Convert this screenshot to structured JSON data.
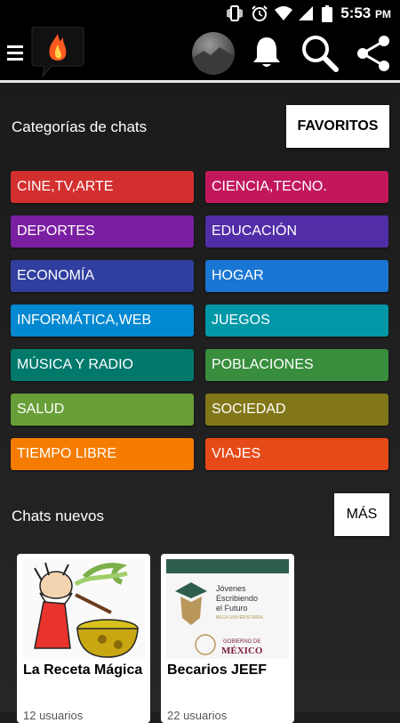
{
  "status": {
    "time": "5:53",
    "ampm": "PM"
  },
  "toolbar": {
    "menu_icon": "hamburger-menu-icon",
    "logo_icon": "fire-chat-logo-icon",
    "avatar_icon": "user-avatar",
    "bell_icon": "bell-icon",
    "search_icon": "search-icon",
    "share_icon": "share-icon"
  },
  "categories_section": {
    "title": "Categorías de chats",
    "favorites_label": "FAVORITOS"
  },
  "categories": [
    {
      "label": "CINE,TV,ARTE",
      "color": "#d32f2f"
    },
    {
      "label": "CIENCIA,TECNO.",
      "color": "#c2185b"
    },
    {
      "label": "DEPORTES",
      "color": "#7b1fa2"
    },
    {
      "label": "EDUCACIÓN",
      "color": "#512da8"
    },
    {
      "label": "ECONOMÍA",
      "color": "#303f9f"
    },
    {
      "label": "HOGAR",
      "color": "#1976d2"
    },
    {
      "label": "INFORMÁTICA,WEB",
      "color": "#0288d1"
    },
    {
      "label": "JUEGOS",
      "color": "#0097a7"
    },
    {
      "label": "MÚSICA Y RADIO",
      "color": "#00796b"
    },
    {
      "label": "POBLACIONES",
      "color": "#388e3c"
    },
    {
      "label": "SALUD",
      "color": "#689f38"
    },
    {
      "label": "SOCIEDAD",
      "color": "#827717"
    },
    {
      "label": "TIEMPO LIBRE",
      "color": "#f57c00"
    },
    {
      "label": "VIAJES",
      "color": "#e64a19"
    }
  ],
  "new_chats_section": {
    "title": "Chats nuevos",
    "more_label": "MÁS"
  },
  "new_chats": [
    {
      "title": "La Receta Mágica",
      "subtitle": "12 usuarios"
    },
    {
      "title": "Becarios JEEF",
      "subtitle": "22 usuarios",
      "logo_lines": [
        "Jóvenes",
        "Escribiendo",
        "el Futuro",
        "BECA UNIVERSITARIA"
      ],
      "gov_lines": [
        "GOBIERNO DE",
        "MÉXICO"
      ]
    }
  ]
}
